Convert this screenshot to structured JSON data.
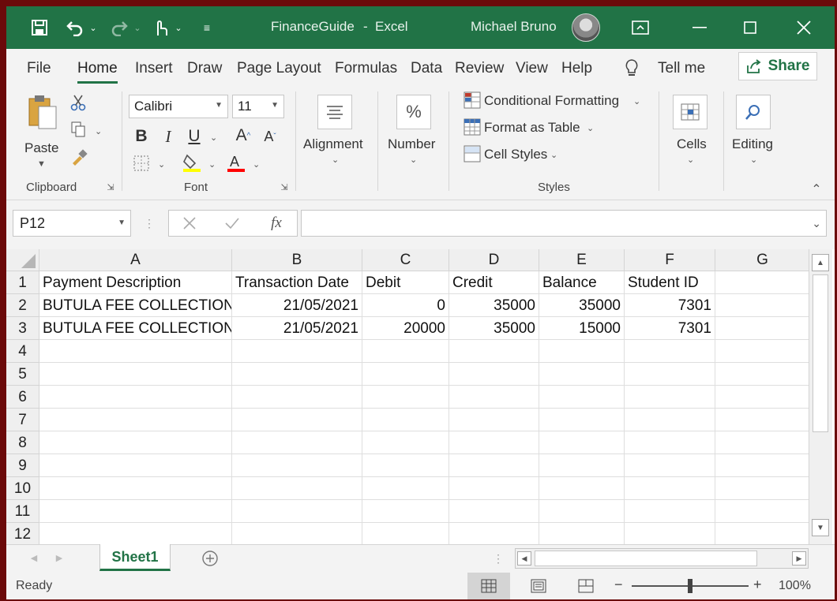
{
  "app": {
    "file_name": "FinanceGuide",
    "title_sep": "-",
    "app_name": "Excel",
    "user": "Michael Bruno"
  },
  "menu": {
    "tabs": [
      "File",
      "Home",
      "Insert",
      "Draw",
      "Page Layout",
      "Formulas",
      "Data",
      "Review",
      "View",
      "Help"
    ],
    "tell_me": "Tell me",
    "share": "Share"
  },
  "ribbon": {
    "paste": "Paste",
    "clipboard": "Clipboard",
    "font_name": "Calibri",
    "font_size": "11",
    "font": "Font",
    "alignment": "Alignment",
    "number": "Number",
    "conditional_formatting": "Conditional Formatting",
    "format_as_table": "Format as Table",
    "cell_styles": "Cell Styles",
    "styles": "Styles",
    "cells": "Cells",
    "editing": "Editing",
    "highlight_color": "#ffff00",
    "font_color": "#ff0000"
  },
  "formula_bar": {
    "name_box": "P12",
    "fx": "fx",
    "content": ""
  },
  "sheet": {
    "columns": [
      "A",
      "B",
      "C",
      "D",
      "E",
      "F",
      "G"
    ],
    "rows": [
      "1",
      "2",
      "3",
      "4",
      "5",
      "6",
      "7",
      "8",
      "9",
      "10",
      "11",
      "12"
    ],
    "cells": [
      [
        "Payment Description",
        "Transaction Date",
        "Debit",
        "Credit",
        "Balance",
        "Student ID",
        ""
      ],
      [
        "BUTULA FEE COLLECTION",
        "21/05/2021",
        "0",
        "35000",
        "35000",
        "7301",
        ""
      ],
      [
        "BUTULA FEE COLLECTION",
        "21/05/2021",
        "20000",
        "35000",
        "15000",
        "7301",
        ""
      ]
    ],
    "tab": "Sheet1"
  },
  "status": {
    "text": "Ready",
    "zoom": "100%",
    "zoom_level": 1.0
  },
  "colors": {
    "accent": "#217346"
  }
}
